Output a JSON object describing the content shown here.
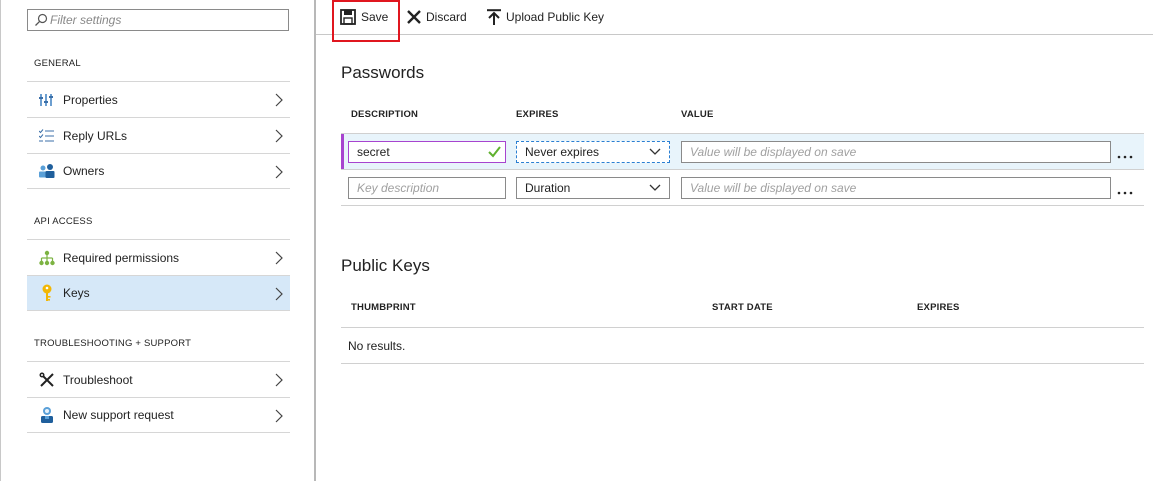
{
  "sidebar": {
    "filter_placeholder": "Filter settings",
    "sections": {
      "general": "GENERAL",
      "api_access": "API ACCESS",
      "troubleshooting": "TROUBLESHOOTING + SUPPORT"
    },
    "items": [
      {
        "label": "Properties",
        "icon": "properties-icon"
      },
      {
        "label": "Reply URLs",
        "icon": "list-icon"
      },
      {
        "label": "Owners",
        "icon": "people-icon"
      },
      {
        "label": "Required permissions",
        "icon": "permissions-icon"
      },
      {
        "label": "Keys",
        "icon": "key-icon",
        "selected": true
      },
      {
        "label": "Troubleshoot",
        "icon": "wrench-icon"
      },
      {
        "label": "New support request",
        "icon": "support-person-icon"
      }
    ]
  },
  "toolbar": {
    "save_label": "Save",
    "discard_label": "Discard",
    "upload_label": "Upload Public Key"
  },
  "passwords": {
    "title": "Passwords",
    "columns": {
      "description": "DESCRIPTION",
      "expires": "EXPIRES",
      "value": "VALUE"
    },
    "rows": [
      {
        "description": "secret",
        "expires": "Never expires",
        "value_placeholder": "Value will be displayed on save"
      },
      {
        "description_placeholder": "Key description",
        "expires": "Duration",
        "value_placeholder": "Value will be displayed on save"
      }
    ]
  },
  "public_keys": {
    "title": "Public Keys",
    "columns": {
      "thumbprint": "THUMBPRINT",
      "start_date": "START DATE",
      "expires": "EXPIRES"
    },
    "empty_text": "No results."
  },
  "colors": {
    "selected_bg": "#d6e8f8",
    "row_highlight": "#e8f4fb",
    "row_accent": "#a744cf",
    "save_outline": "#e0161f",
    "check_green": "#5fb12e"
  }
}
